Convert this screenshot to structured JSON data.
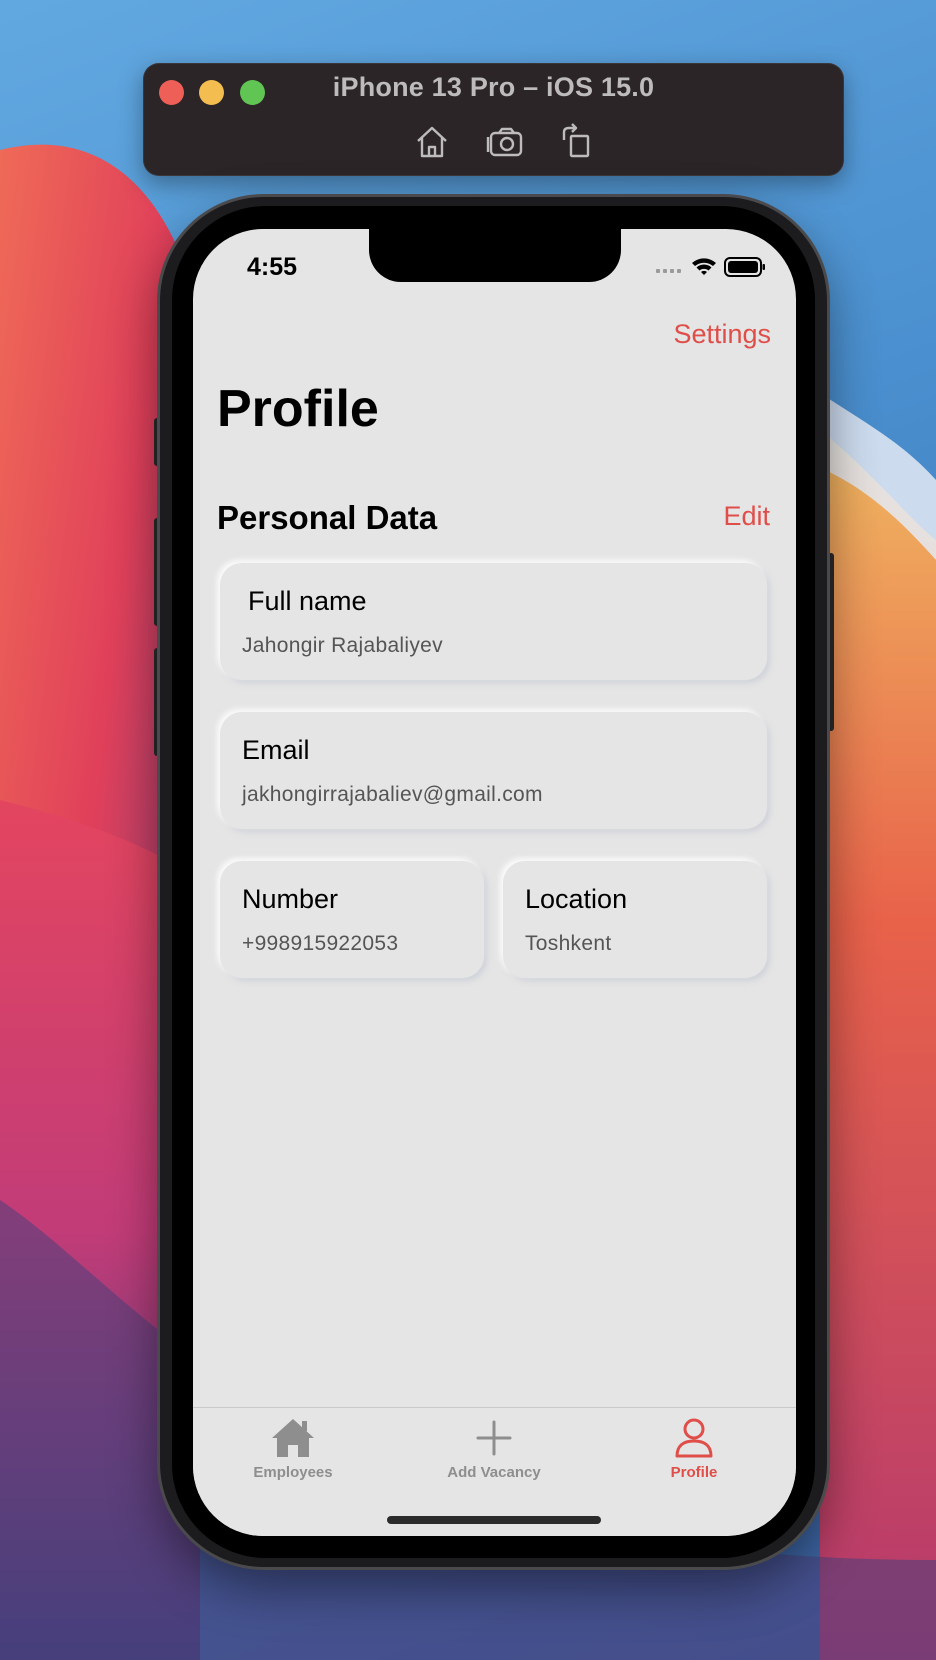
{
  "simulator": {
    "title": "iPhone 13 Pro – iOS 15.0",
    "tools": [
      "home-icon",
      "screenshot-icon",
      "rotate-icon"
    ]
  },
  "status_bar": {
    "time": "4:55"
  },
  "nav": {
    "settings_label": "Settings"
  },
  "page": {
    "title": "Profile"
  },
  "personal_data": {
    "section_title": "Personal Data",
    "edit_label": "Edit",
    "full_name": {
      "label": "Full name",
      "value": "Jahongir Rajabaliyev"
    },
    "email": {
      "label": "Email",
      "value": "jakhongirrajabaliev@gmail.com"
    },
    "number": {
      "label": "Number",
      "value": "+998915922053"
    },
    "location": {
      "label": "Location",
      "value": "Toshkent"
    }
  },
  "tabs": [
    {
      "label": "Employees",
      "icon": "house-icon",
      "active": false
    },
    {
      "label": "Add Vacancy",
      "icon": "plus-icon",
      "active": false
    },
    {
      "label": "Profile",
      "icon": "person-icon",
      "active": true
    }
  ],
  "colors": {
    "accent": "#e04e4a",
    "inactive": "#8e8e8e",
    "screen_bg": "#e5e5e5"
  }
}
